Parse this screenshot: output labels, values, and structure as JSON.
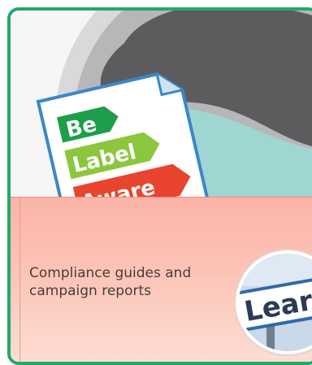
{
  "card": {
    "border_color": "#23a86a",
    "hero": {
      "image": "be-label-aware-document-graphic",
      "labels": [
        "Be",
        "Label",
        "Aware"
      ]
    },
    "caption_lines": [
      "Compliance guides and",
      "campaign reports"
    ],
    "thumbnail": {
      "image": "learn-road-sign",
      "sign_text": "Lear"
    }
  }
}
